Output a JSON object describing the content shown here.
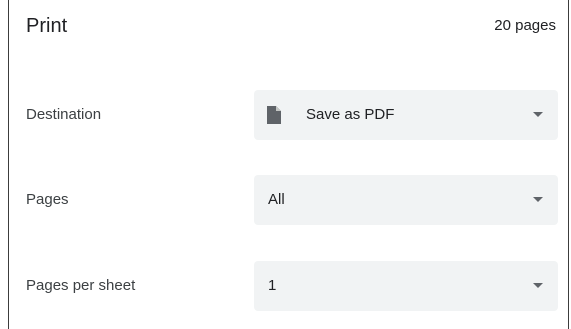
{
  "header": {
    "title": "Print",
    "page_count": "20 pages"
  },
  "settings": {
    "destination": {
      "label": "Destination",
      "value": "Save as PDF",
      "icon": "document-icon"
    },
    "pages": {
      "label": "Pages",
      "value": "All"
    },
    "pages_per_sheet": {
      "label": "Pages per sheet",
      "value": "1"
    }
  },
  "colors": {
    "select_background": "#f1f3f4",
    "caret": "#5f6368",
    "icon": "#5f6368"
  }
}
